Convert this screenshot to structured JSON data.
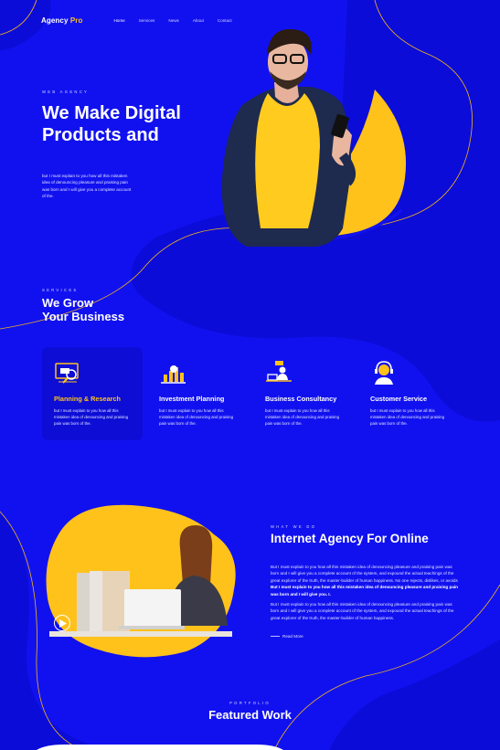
{
  "nav": {
    "logo_main": "Agency",
    "logo_accent": "Pro",
    "items": [
      {
        "label": "Home",
        "active": true
      },
      {
        "label": "Services",
        "active": false
      },
      {
        "label": "News",
        "active": false
      },
      {
        "label": "About",
        "active": false
      },
      {
        "label": "Contact",
        "active": false
      }
    ]
  },
  "hero": {
    "kicker": "WEB AGENCY",
    "title_line1": "We Make Digital",
    "title_line2": "Products and",
    "text": "but I must explain to you how all this mistaken idea of denouncing pleasure and praising pain was born and I will give you a complete account of the."
  },
  "services": {
    "kicker": "SERVICES",
    "title_line1": "We Grow",
    "title_line2": "Your Business",
    "items": [
      {
        "title": "Planning & Research",
        "icon": "planning-research-icon",
        "text": "but I must explain to you how all this mistaken idea of denouncing and praising pain was born of the."
      },
      {
        "title": "Investment Planning",
        "icon": "investment-planning-icon",
        "text": "but I must explain to you how all this mistaken idea of denouncing and praising pain was born of the."
      },
      {
        "title": "Business Consultancy",
        "icon": "business-consultancy-icon",
        "text": "but I must explain to you how all this mistaken idea of denouncing and praising pain was born of the."
      },
      {
        "title": "Customer Service",
        "icon": "customer-service-icon",
        "text": "but I must explain to you how all this mistaken idea of denouncing and praising pain was born of the."
      }
    ]
  },
  "about": {
    "kicker": "WHAT WE DO",
    "title": "Internet Agency For Online",
    "para1": "But I must explain to you how all this mistaken idea of denouncing pleasure and praising pain was born and I will give you a complete account of the system, and expound the actual teachings of the great explorer of the truth, the master-builder of human happiness. No one rejects, dislikes, or avoids",
    "para1_bold": "But I must explain to you how all this mistaken idea of denouncing pleasure and praising pain was born and I will give you. I.",
    "para2": "But I must explain to you how all this mistaken idea of denouncing pleasure and praising pain was born and I will give you a complete account of the system, and expound the actual teachings of the great explorer of the truth, the master-builder of human happiness.",
    "read_more": "Read More"
  },
  "portfolio": {
    "kicker": "PORTFOLIO",
    "title": "Featured Work"
  },
  "colors": {
    "background": "#1111f0",
    "accent": "#ffc21a",
    "card": "#0d0dd6"
  }
}
